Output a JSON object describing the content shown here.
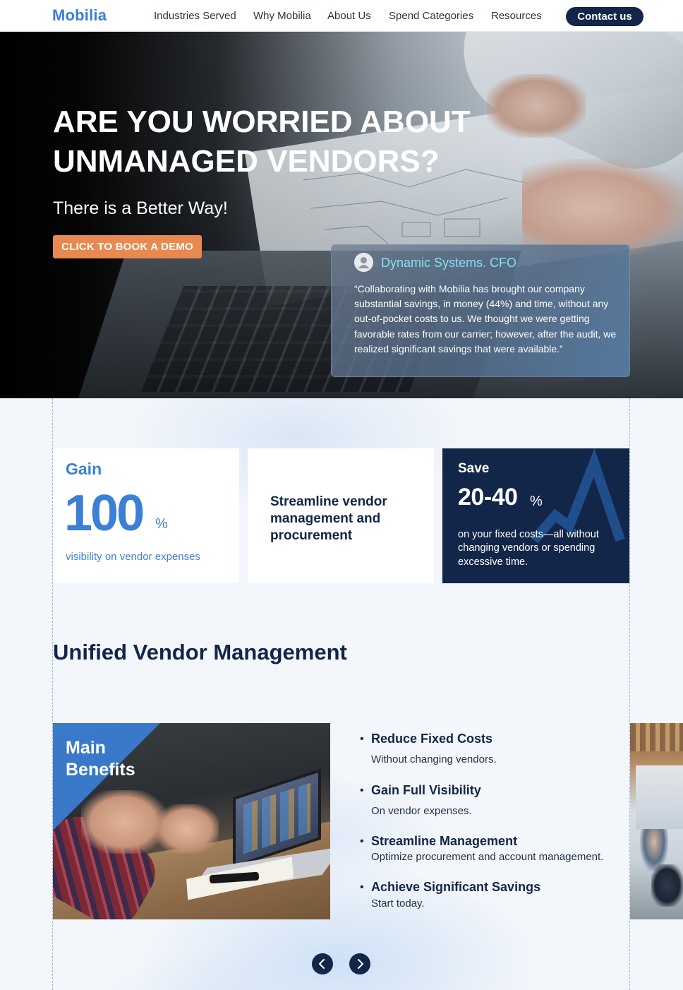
{
  "brand": {
    "logo": "Mobilia"
  },
  "nav": {
    "links": [
      "Industries Served",
      "Why Mobilia",
      "About Us",
      "Spend Categories",
      "Resources"
    ],
    "cta": "Contact us"
  },
  "hero": {
    "title": "ARE YOU WORRIED ABOUT UNMANAGED VENDORS?",
    "subtitle": "There is a Better Way!",
    "button": "CLICK TO BOOK A DEMO",
    "testimonial": {
      "author": "Dynamic Systems.  CFO",
      "quote": "“Collaborating with Mobilia has brought our company substantial savings, in money (44%) and time, without any out-of-pocket costs to us. We thought we were getting favorable rates from our carrier; however, after the audit, we realized significant savings that were available.”"
    }
  },
  "stats": {
    "gain": {
      "label": "Gain",
      "value": "100",
      "unit": "%",
      "description": "visibility on vendor expenses"
    },
    "streamline": {
      "text": "Streamline vendor management and procurement"
    },
    "save": {
      "label": "Save",
      "value": "20-40",
      "unit": "%",
      "description": "on your fixed costs—all without changing vendors or spending excessive time."
    }
  },
  "section": {
    "title": "Unified Vendor Management"
  },
  "benefits": {
    "image_label": "Main Benefits",
    "items": [
      {
        "title": "Reduce Fixed Costs",
        "description": "Without changing vendors."
      },
      {
        "title": "Gain Full Visibility",
        "description": "On vendor expenses."
      },
      {
        "title": "Streamline Management",
        "description": "Optimize procurement and account management."
      },
      {
        "title": "Achieve Significant Savings",
        "description": "Start today."
      }
    ]
  },
  "carousel": {
    "prev_icon": "chevron-left-icon",
    "next_icon": "chevron-right-icon"
  },
  "colors": {
    "brand_blue": "#3b7fd6",
    "navy": "#12264a",
    "cta_orange": "#e8894f",
    "testimonial_name": "#7fe2f2"
  }
}
